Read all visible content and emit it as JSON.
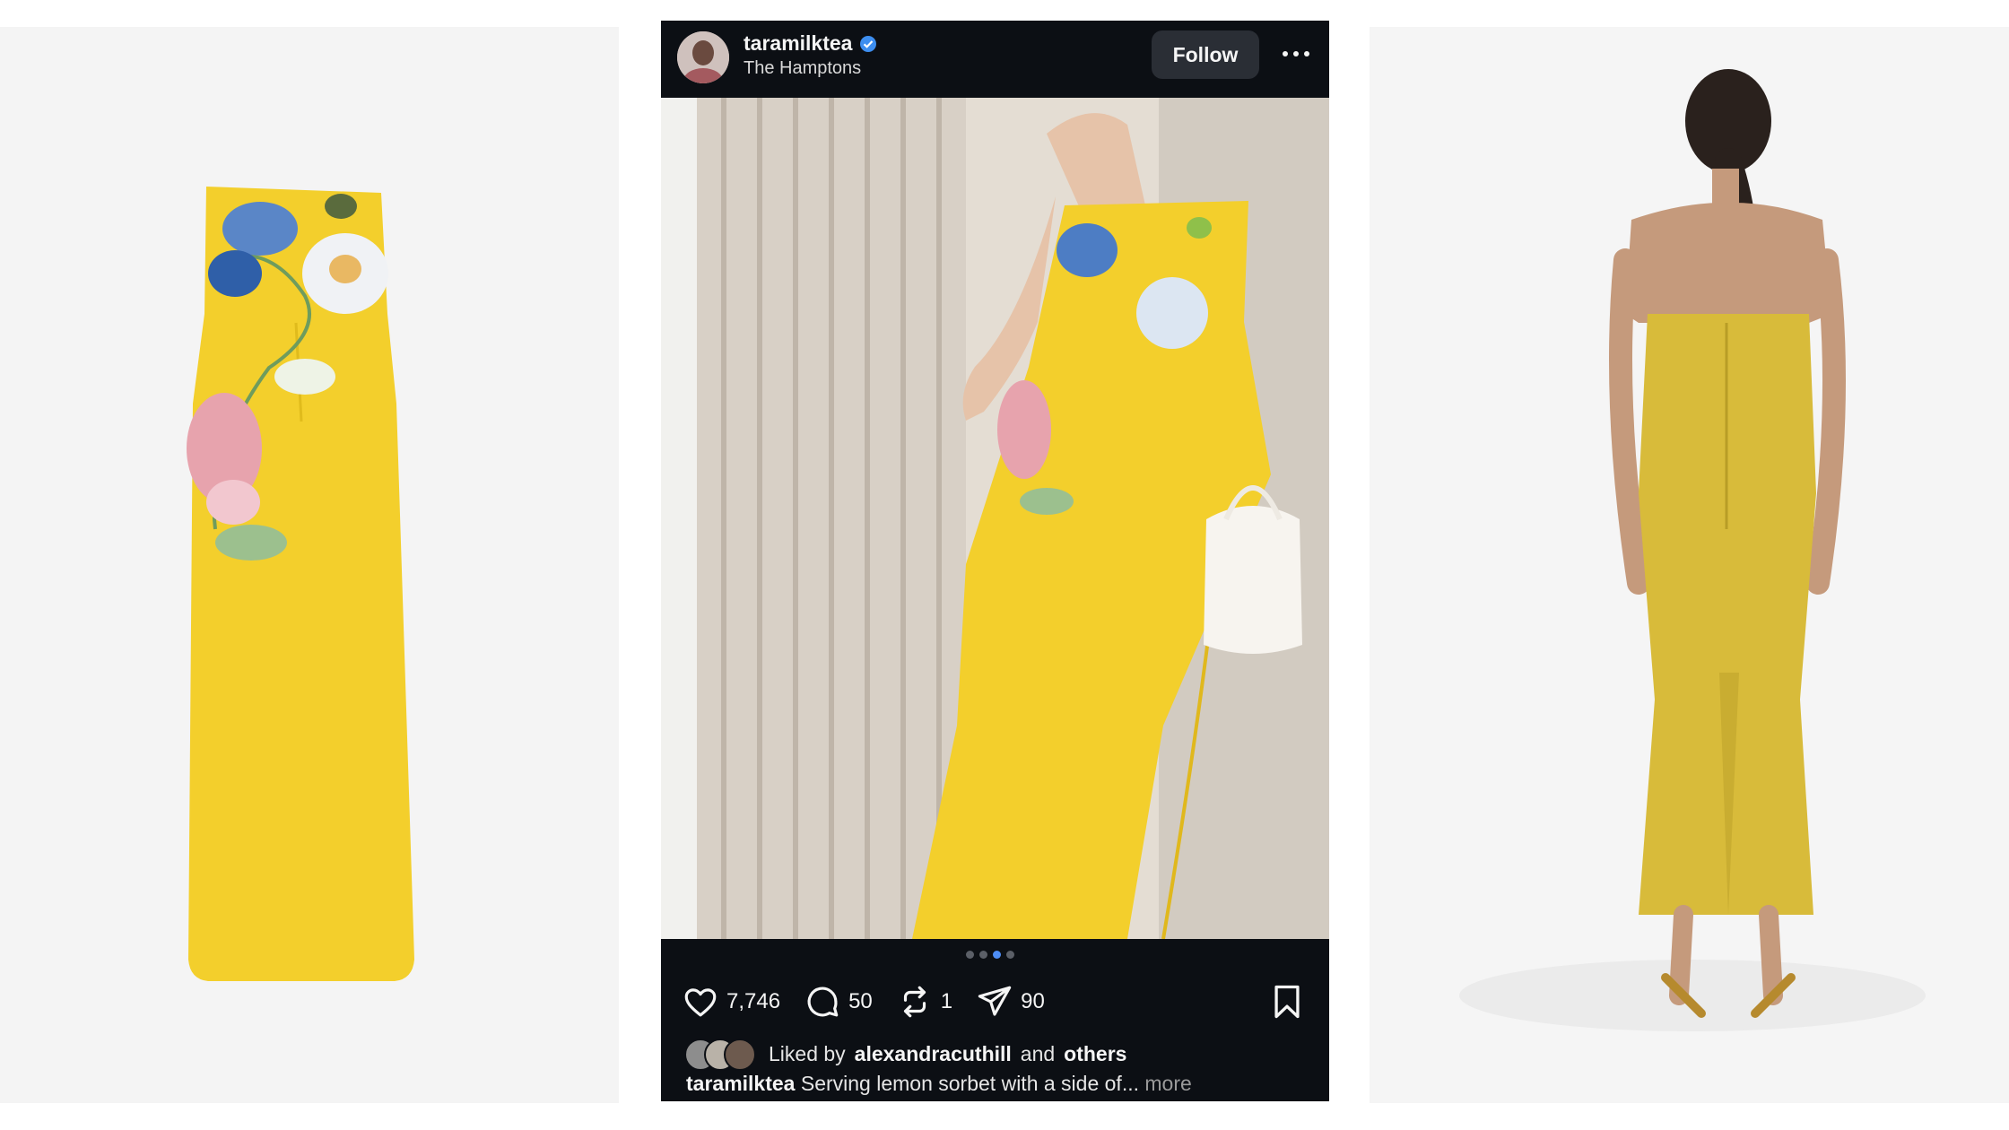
{
  "post": {
    "username": "taramilktea",
    "location": "The Hamptons",
    "follow_label": "Follow",
    "carousel": {
      "total": 4,
      "active_index": 2
    },
    "stats": {
      "likes": "7,746",
      "comments": "50",
      "reposts": "1",
      "shares": "90"
    },
    "liked_by": {
      "prefix": "Liked by",
      "user": "alexandracuthill",
      "and": "and",
      "others": "others"
    },
    "caption": {
      "user": "taramilktea",
      "text": "Serving lemon sorbet with a side of...",
      "more": "more"
    }
  },
  "colors": {
    "dress_yellow": "#f3cf2c",
    "dress_mustard": "#d8bb3a",
    "verified_blue": "#3d8ef0",
    "post_background": "#0c0f14"
  },
  "icons": [
    "verified-badge-icon",
    "more-options-icon",
    "heart-icon",
    "comment-icon",
    "repost-icon",
    "share-icon",
    "bookmark-icon"
  ]
}
